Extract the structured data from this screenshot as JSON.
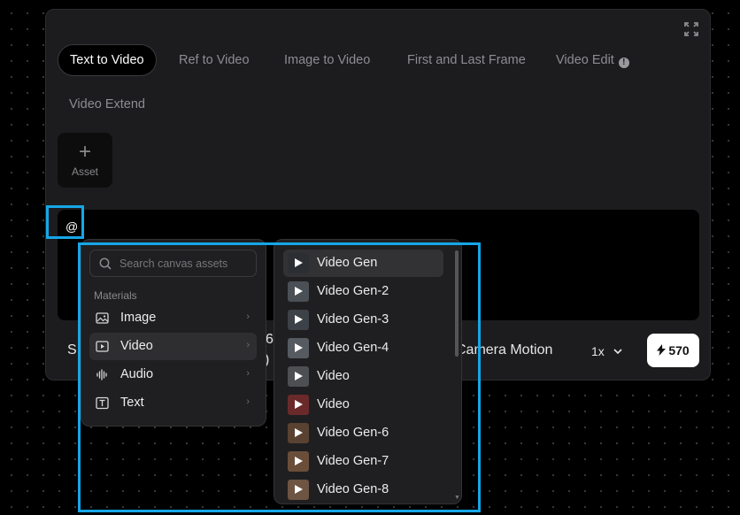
{
  "tabs": [
    {
      "label": "Text to Video",
      "active": true
    },
    {
      "label": "Ref to Video",
      "active": false
    },
    {
      "label": "Image to Video",
      "active": false
    },
    {
      "label": "First and Last Frame",
      "active": false
    },
    {
      "label": "Video Edit",
      "active": false
    },
    {
      "label": "Video Extend",
      "active": false
    }
  ],
  "asset_button": {
    "label": "Asset",
    "icon": "plus-icon"
  },
  "prompt": {
    "text": "@"
  },
  "bottom": {
    "frag1": "S",
    "frag2": "6",
    "frag3": ")",
    "camera_motion": "Camera Motion",
    "speed": "1x",
    "credits": "570"
  },
  "materials_menu": {
    "search_placeholder": "Search canvas assets",
    "section_label": "Materials",
    "items": [
      {
        "label": "Image",
        "icon": "image-icon"
      },
      {
        "label": "Video",
        "icon": "video-icon",
        "active": true
      },
      {
        "label": "Audio",
        "icon": "audio-icon"
      },
      {
        "label": "Text",
        "icon": "text-icon"
      }
    ]
  },
  "video_menu": {
    "items": [
      {
        "label": "Video Gen",
        "active": true,
        "thumb": "#2b2f33"
      },
      {
        "label": "Video Gen-2",
        "thumb": "#4a5055"
      },
      {
        "label": "Video Gen-3",
        "thumb": "#3c4247"
      },
      {
        "label": "Video Gen-4",
        "thumb": "#555b60"
      },
      {
        "label": "Video",
        "thumb": "#4d4f52"
      },
      {
        "label": "Video",
        "thumb": "#6a2a2a"
      },
      {
        "label": "Video Gen-6",
        "thumb": "#5a4232"
      },
      {
        "label": "Video Gen-7",
        "thumb": "#6b4e3a"
      },
      {
        "label": "Video Gen-8",
        "thumb": "#6e5442"
      }
    ]
  },
  "colors": {
    "highlight": "#16a6e8",
    "panel": "#1c1c1e",
    "menu": "#1f1f21"
  }
}
